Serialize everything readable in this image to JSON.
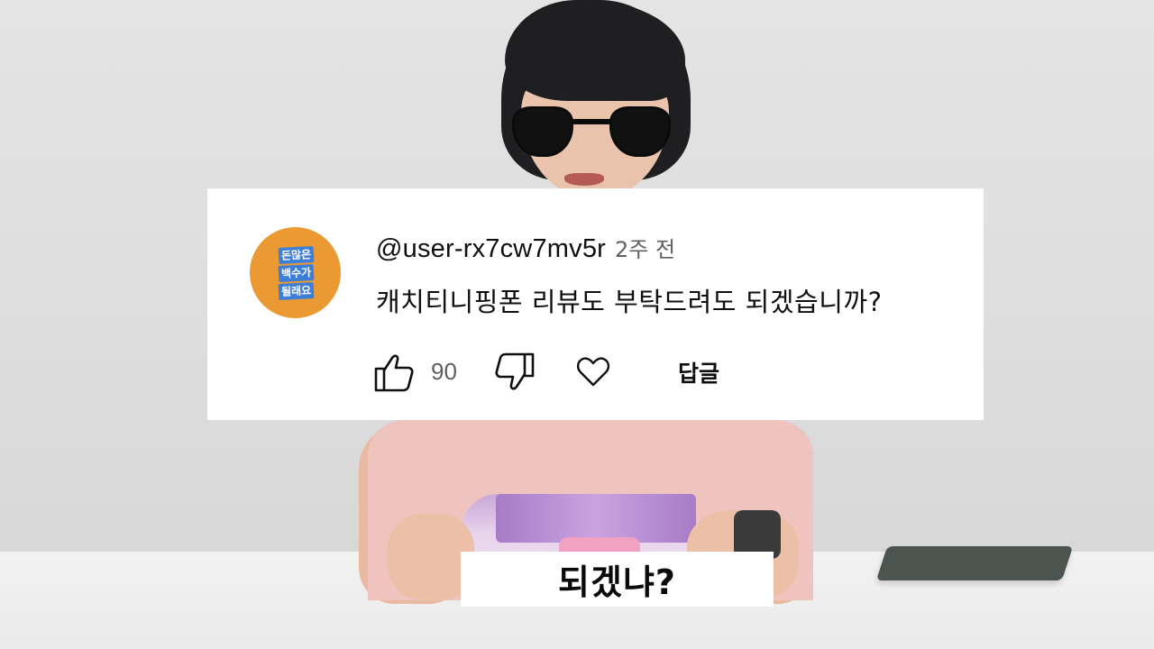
{
  "comment": {
    "avatar_text_lines": [
      "돈많은",
      "백수가",
      "될래요"
    ],
    "username": "@user-rx7cw7mv5r",
    "timestamp": "2주 전",
    "text": "캐치티니핑폰 리뷰도 부탁드려도 되겠습니까?",
    "like_count": "90",
    "reply_label": "답글",
    "icons": [
      "thumbs-up-icon",
      "thumbs-down-icon",
      "heart-icon"
    ]
  },
  "caption": {
    "text": "되겠냐?"
  },
  "colors": {
    "card_background": "#ffffff",
    "avatar_background": "#eb9a33",
    "avatar_badge": "#3d7fd8",
    "secondary_text": "#606060",
    "primary_text": "#0f0f0f"
  }
}
